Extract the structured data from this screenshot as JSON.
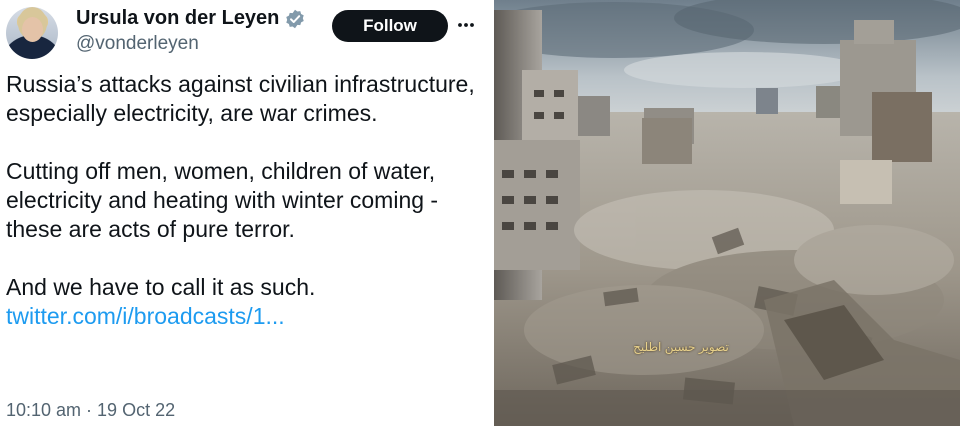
{
  "tweet": {
    "author_name": "Ursula von der Leyen",
    "handle": "@vonderleyen",
    "follow_label": "Follow",
    "paragraphs": {
      "p1": "Russia’s attacks against civilian infrastructure, especially electricity, are war crimes.",
      "p2": "Cutting off men, women, children of water, electricity and heating with winter coming - these are acts of pure terror.",
      "p3_text": "And we have to call it as such. ",
      "p3_link": "twitter.com/i/broadcasts/1..."
    },
    "timestamp": "10:10 am · 19 Oct 22",
    "icons": {
      "verified": "verified-badge-icon",
      "more": "more-options-icon"
    }
  },
  "photo": {
    "watermark": "تصوير حسين اطليح"
  },
  "colors": {
    "text": "#0f1419",
    "secondary": "#536471",
    "link": "#1d9bf0",
    "follow_bg": "#0f1419",
    "verified": "#829aab"
  }
}
